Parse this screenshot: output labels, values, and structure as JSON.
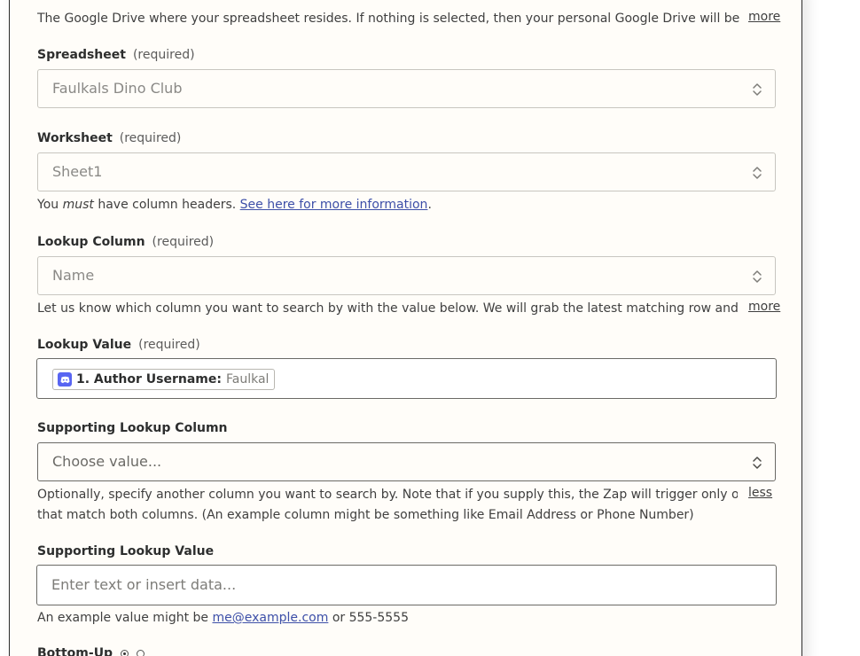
{
  "drive": {
    "description": "The Google Drive where your spreadsheet resides. If nothing is selected, then your personal Google Drive will be used...",
    "more_label": "more"
  },
  "spreadsheet": {
    "label": "Spreadsheet",
    "required": "(required)",
    "value": "Faulkals Dino Club"
  },
  "worksheet": {
    "label": "Worksheet",
    "required": "(required)",
    "value": "Sheet1",
    "help_prefix": "You",
    "help_em": "must",
    "help_mid": "have column headers.",
    "help_link": "See here for more information",
    "help_suffix": "."
  },
  "lookup_column": {
    "label": "Lookup Column",
    "required": "(required)",
    "value": "Name",
    "description": "Let us know which column you want to search by with the value below. We will grab the latest matching row and give...",
    "more_label": "more"
  },
  "lookup_value": {
    "label": "Lookup Value",
    "required": "(required)",
    "pill_key": "1. Author Username:",
    "pill_value": "Faulkal",
    "pill_icon": "discord-icon"
  },
  "supporting_column": {
    "label": "Supporting Lookup Column",
    "placeholder": "Choose value...",
    "description_line1": "Optionally, specify another column you want to search by. Note that if you supply this, the Zap will trigger only on rows",
    "description_line2": "that match both columns. (An example column might be something like Email Address or Phone Number)",
    "less_label": "less"
  },
  "supporting_value": {
    "label": "Supporting Lookup Value",
    "placeholder": "Enter text or insert data...",
    "help_prefix": "An example value might be",
    "help_link": "me@example.com",
    "help_suffix": "or 555-5555"
  },
  "bottom_up": {
    "label": "Bottom-Up"
  },
  "colors": {
    "accent_link": "#3d4fa8",
    "discord": "#5865f2",
    "panel_bg": "#fffdf9"
  }
}
